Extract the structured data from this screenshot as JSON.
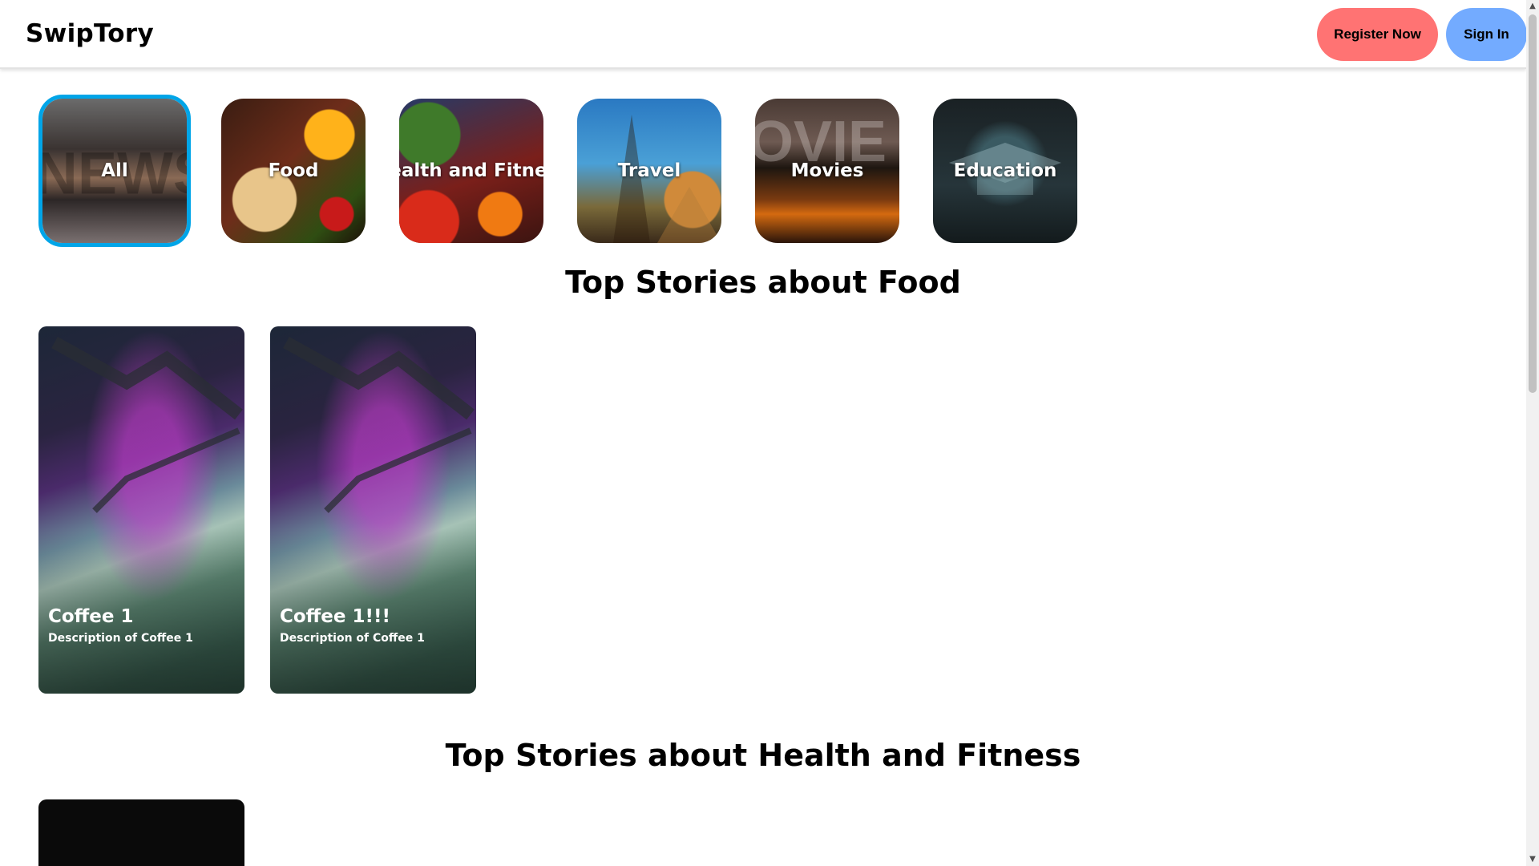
{
  "header": {
    "logo": "SwipTory",
    "register_label": "Register Now",
    "signin_label": "Sign In"
  },
  "categories": [
    {
      "label": "All",
      "selected": true
    },
    {
      "label": "Food",
      "selected": false
    },
    {
      "label": "Health and Fitness",
      "selected": false
    },
    {
      "label": "Travel",
      "selected": false
    },
    {
      "label": "Movies",
      "selected": false
    },
    {
      "label": "Education",
      "selected": false
    }
  ],
  "sections": [
    {
      "title": "Top Stories about Food",
      "stories": [
        {
          "title": "Coffee 1",
          "description": "Description of Coffee 1"
        },
        {
          "title": "Coffee 1!!!",
          "description": "Description of Coffee 1"
        }
      ]
    },
    {
      "title": "Top Stories about Health and Fitness",
      "stories": []
    }
  ],
  "colors": {
    "register_button": "#ff7373",
    "signin_button": "#73abff",
    "selected_border": "#00a5e8"
  }
}
